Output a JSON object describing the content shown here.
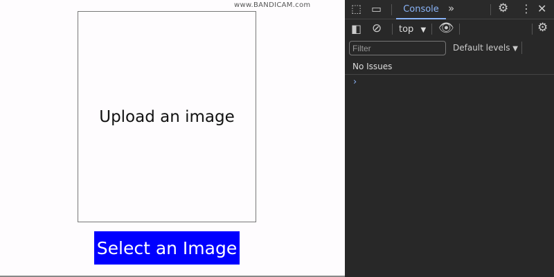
{
  "watermark": "www.BANDICAM.com",
  "page": {
    "upload_text": "Upload an image",
    "select_button": "Select an Image"
  },
  "devtools": {
    "tab": "Console",
    "more_tabs": "»",
    "context": "top",
    "filter_placeholder": "Filter",
    "levels": "Default levels",
    "issues": "No Issues",
    "prompt": "›"
  }
}
